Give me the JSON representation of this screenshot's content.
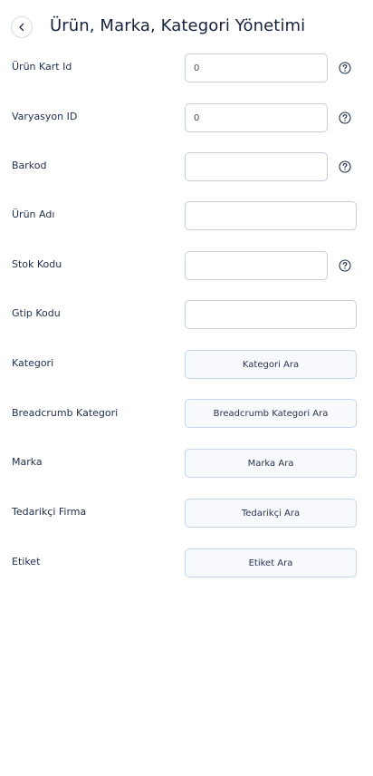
{
  "header": {
    "title": "Ürün, Marka, Kategori Yönetimi",
    "back_icon": "chevron-left-icon"
  },
  "fields": {
    "product_card_id": {
      "label": "Ürün Kart Id",
      "value": "0",
      "help_icon": "question-circle-icon"
    },
    "variation_id": {
      "label": "Varyasyon ID",
      "value": "0",
      "help_icon": "question-circle-icon"
    },
    "barcode": {
      "label": "Barkod",
      "value": "",
      "help_icon": "question-circle-icon"
    },
    "product_name": {
      "label": "Ürün Adı",
      "value": ""
    },
    "stock_code": {
      "label": "Stok Kodu",
      "value": "",
      "help_icon": "question-circle-icon"
    },
    "gtip_code": {
      "label": "Gtip Kodu",
      "value": ""
    }
  },
  "searches": {
    "category": {
      "label": "Kategori",
      "button": "Kategori Ara"
    },
    "breadcrumb_category": {
      "label": "Breadcrumb Kategori",
      "button": "Breadcrumb Kategori Ara"
    },
    "brand": {
      "label": "Marka",
      "button": "Marka Ara"
    },
    "supplier": {
      "label": "Tedarikçi Firma",
      "button": "Tedarikçi Ara"
    },
    "tag": {
      "label": "Etiket",
      "button": "Etiket Ara"
    }
  },
  "colors": {
    "text": "#1f2d4a",
    "input_border": "#c8ced8",
    "button_border": "#c6d4ea",
    "button_bg": "#f7f9fc"
  }
}
